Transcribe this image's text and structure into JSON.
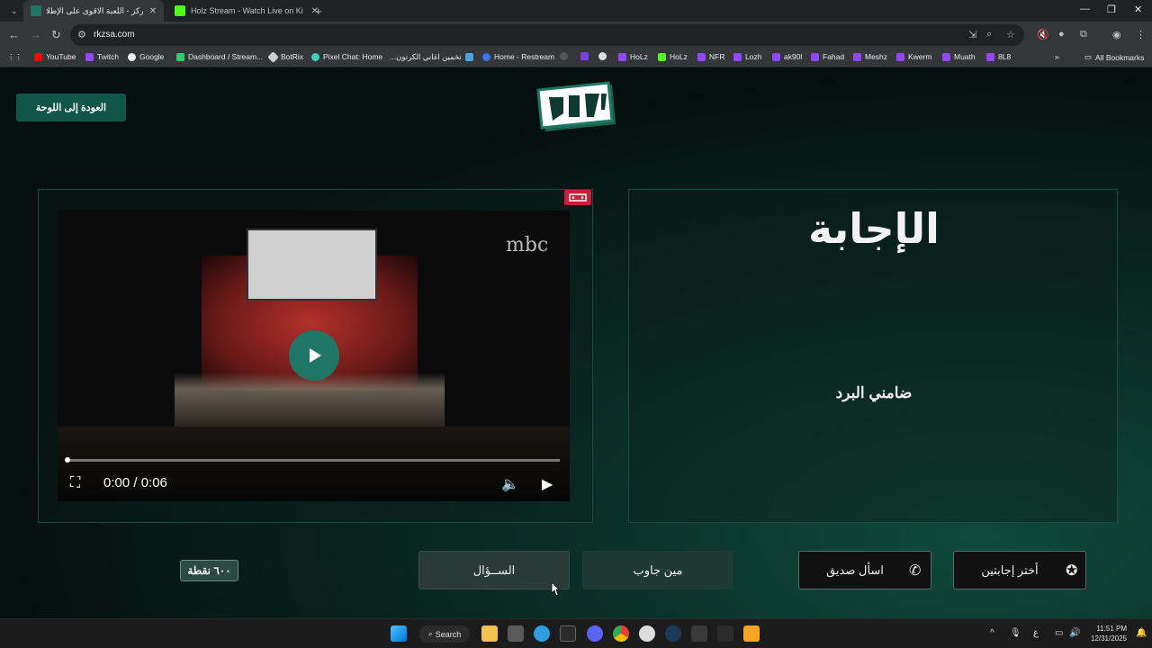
{
  "browser": {
    "tabs": [
      {
        "title": "ركز - اللعبة الاقوى على الإطلاق",
        "active": true
      },
      {
        "title": "Holz Stream - Watch Live on Ki",
        "active": false
      }
    ],
    "new_tab_label": "+",
    "url": "rkzsa.com",
    "bookmarks": [
      "YouTube",
      "Twitch",
      "Google",
      "Dashboard / Stream...",
      "BotRix",
      "Pixel Chat: Home",
      "تخمين اغاني الكرتون...",
      "Home - Restream",
      "HoLz",
      "HoLz",
      "NFR",
      "Lozh",
      "ak90l",
      "Fahad",
      "Meshz",
      "Kwerm",
      "Muath",
      "8L8"
    ],
    "all_bookmarks": "All Bookmarks"
  },
  "page": {
    "back_button": "العودة إلى اللوحة",
    "logo_text": "ركز!",
    "answer_title": "الإجابة",
    "answer_text": "ضامني البرد",
    "video": {
      "watermark": "mbc",
      "time": "0:00 / 0:06",
      "progress": 0.0
    },
    "points": "٦٠٠ نقطة",
    "buttons": {
      "question": "الســؤال",
      "who_answered": "مين جاوب",
      "ask_friend": "اسأل صديق",
      "pick_two": "أختر إجابتين"
    }
  },
  "taskbar": {
    "search": "Search",
    "time": "11:51 PM",
    "date": "12/31/2025",
    "lang": "ع"
  },
  "colors": {
    "accent": "#10574a",
    "play_button": "#1f7566",
    "record_badge": "#c81e3a"
  }
}
